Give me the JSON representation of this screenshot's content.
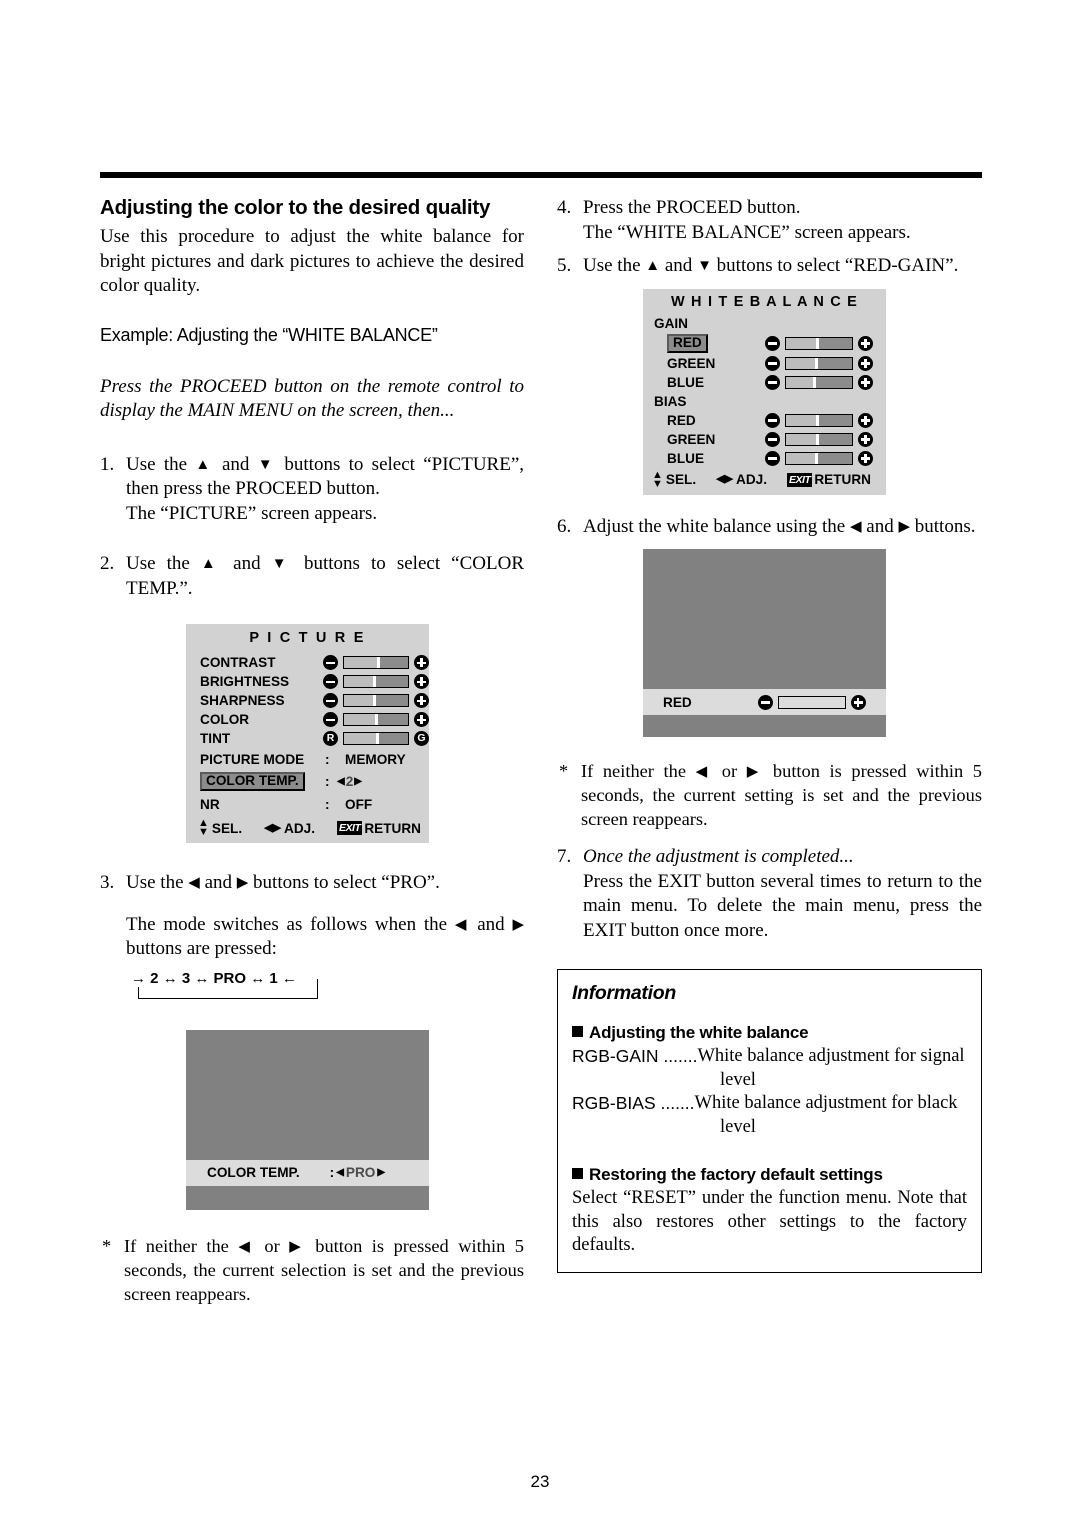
{
  "page": {
    "number": "23"
  },
  "left": {
    "title": "Adjusting the color to the desired quality",
    "intro": "Use this procedure to adjust the white balance for bright pictures and dark pictures to achieve the desired color quality.",
    "example": "Example: Adjusting the “WHITE BALANCE”",
    "italic_note": "Press the PROCEED button on the remote control to display the MAIN MENU on the screen, then...",
    "step1": {
      "num": "1.",
      "line1_a": "Use the ",
      "line1_b": " and ",
      "line1_c": " buttons to select “PICTURE”, then press the PROCEED button.",
      "line2": "The “PICTURE” screen appears."
    },
    "step2": {
      "num": "2.",
      "a": "Use the ",
      "b": " and ",
      "c": " buttons to select “COLOR TEMP.”."
    },
    "step3": {
      "num": "3.",
      "a": "Use the ",
      "b": " and ",
      "c": " buttons to select “PRO”.",
      "line2_a": "The mode switches as follows when the ",
      "line2_b": " and ",
      "line2_c": " buttons are pressed:"
    },
    "cycle": {
      "arrow_in": "→",
      "items": [
        "2",
        "3",
        "PRO",
        "1"
      ],
      "sep": "↔",
      "arrow_out": "←"
    },
    "note": {
      "star": "*",
      "a": "If neither the ",
      "b": " or ",
      "c": " button is pressed within 5 seconds, the current selection is set and the previous screen reappears."
    }
  },
  "picture_menu": {
    "title": "P I C T U R E",
    "rows": [
      {
        "label": "CONTRAST",
        "type": "slider",
        "fill_pct": 57,
        "minus": "minus-icon",
        "plus": "plus-icon"
      },
      {
        "label": "BRIGHTNESS",
        "type": "slider",
        "fill_pct": 50,
        "minus": "minus-icon",
        "plus": "plus-icon"
      },
      {
        "label": "SHARPNESS",
        "type": "slider",
        "fill_pct": 50,
        "minus": "minus-icon",
        "plus": "plus-icon"
      },
      {
        "label": "COLOR",
        "type": "slider",
        "fill_pct": 53,
        "minus": "minus-icon",
        "plus": "plus-icon"
      },
      {
        "label": "TINT",
        "type": "slider_rg",
        "fill_pct": 55,
        "left_icon": "R",
        "right_icon": "G"
      },
      {
        "label": "PICTURE MODE",
        "type": "value",
        "colon": ":",
        "value": "MEMORY"
      },
      {
        "label": "COLOR TEMP.",
        "type": "value_adj",
        "colon": ":",
        "value": "2",
        "highlight": true,
        "left_arrow": "◀",
        "right_arrow": "▶"
      },
      {
        "label": "NR",
        "type": "value",
        "colon": ":",
        "value": "OFF"
      }
    ],
    "footer": {
      "sel": "SEL.",
      "adj": "ADJ.",
      "exit": "EXIT",
      "return": "RETURN",
      "updown_icon": "up-down-arrow-icon",
      "leftright_icon": "left-right-arrow-icon"
    }
  },
  "colortemp_screen": {
    "label": "COLOR TEMP.",
    "colon": ":",
    "left_arrow": "◀",
    "value": "PRO",
    "right_arrow": "▶"
  },
  "right": {
    "step4": {
      "num": "4.",
      "line1": "Press the PROCEED button.",
      "line2": "The “WHITE BALANCE” screen appears."
    },
    "step5": {
      "num": "5.",
      "a": "Use the ",
      "b": " and ",
      "c": " buttons to select “RED-GAIN”."
    },
    "step6": {
      "num": "6.",
      "a": "Adjust the white balance using the ",
      "b": " and ",
      "c": " buttons."
    },
    "note": {
      "star": "*",
      "a": "If neither the ",
      "b": " or ",
      "c": " button is pressed within 5 seconds, the current setting is set and the previous screen reappears."
    },
    "step7": {
      "num": "7.",
      "italic": "Once the adjustment is completed...",
      "body": "Press the EXIT button several times to return to the main menu. To delete the main menu, press the EXIT button once more."
    }
  },
  "white_balance_menu": {
    "title": "W H I T E   B A L A N C E",
    "group1": "GAIN",
    "group2": "BIAS",
    "rows": [
      {
        "label": "RED",
        "group": "GAIN",
        "fill_pct": 50,
        "highlight": true
      },
      {
        "label": "GREEN",
        "group": "GAIN",
        "fill_pct": 48,
        "highlight": false
      },
      {
        "label": "BLUE",
        "group": "GAIN",
        "fill_pct": 46,
        "highlight": false
      },
      {
        "label": "RED",
        "group": "BIAS",
        "fill_pct": 50,
        "highlight": false
      },
      {
        "label": "GREEN",
        "group": "BIAS",
        "fill_pct": 50,
        "highlight": false
      },
      {
        "label": "BLUE",
        "group": "BIAS",
        "fill_pct": 48,
        "highlight": false
      }
    ],
    "footer": {
      "sel": "SEL.",
      "adj": "ADJ.",
      "exit": "EXIT",
      "return": "RETURN"
    }
  },
  "red_screen": {
    "label": "RED",
    "fill_pct": 0
  },
  "information": {
    "title": "Information",
    "section1_head": "Adjusting the white balance",
    "defs": [
      {
        "term": "RGB-GAIN .......",
        "desc": "White balance adjustment for signal",
        "desc2": "level"
      },
      {
        "term": "RGB-BIAS .......",
        "desc": "White balance adjustment for black",
        "desc2": "level"
      }
    ],
    "section2_head": "Restoring the factory default settings",
    "section2_body": "Select “RESET” under the function menu. Note that this also restores other settings to the factory defaults."
  },
  "colors": {
    "osd_bg": "#d2d2d2",
    "screen_gray": "#818181",
    "bar_track": "#8c8c8c",
    "bar_fill": "#bdbdbd",
    "highlight": "#8c8c8c"
  }
}
